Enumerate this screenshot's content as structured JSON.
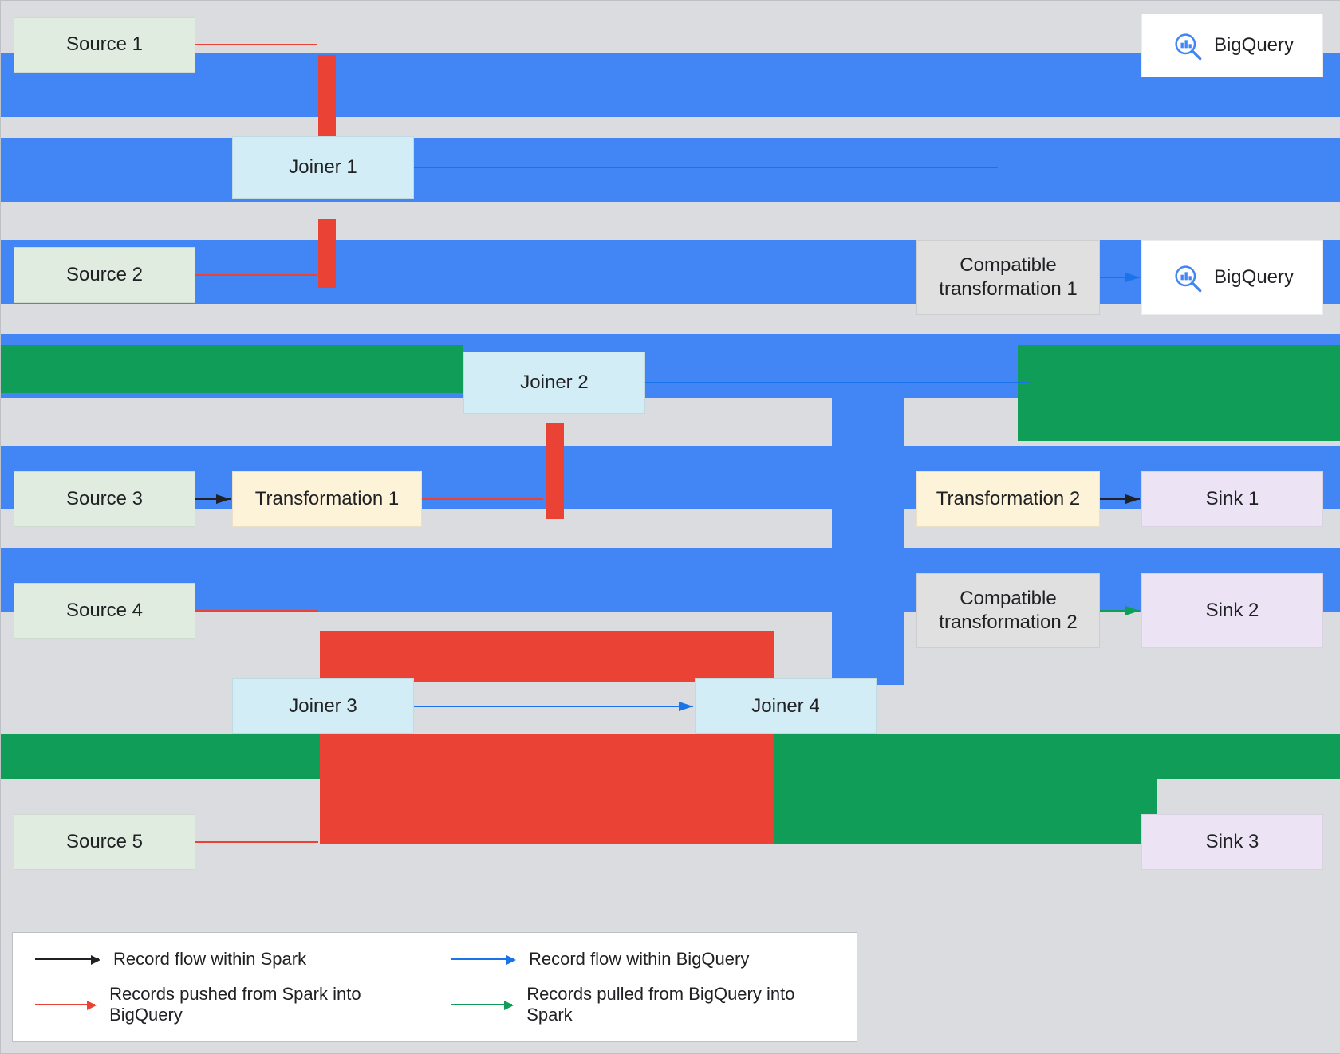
{
  "nodes": {
    "source1": "Source 1",
    "source2": "Source 2",
    "source3": "Source 3",
    "source4": "Source 4",
    "source5": "Source 5",
    "joiner1": "Joiner 1",
    "joiner2": "Joiner 2",
    "joiner3": "Joiner 3",
    "joiner4": "Joiner 4",
    "trans1": "Transformation 1",
    "trans2": "Transformation 2",
    "comp1": "Compatible transformation 1",
    "comp2": "Compatible transformation 2",
    "sink1": "Sink 1",
    "sink2": "Sink 2",
    "sink3": "Sink 3",
    "bigquery": "BigQuery"
  },
  "legend": {
    "black": "Record flow within Spark",
    "blue": "Record flow within BigQuery",
    "red": "Records pushed from Spark into BigQuery",
    "green": "Records pulled from BigQuery into Spark"
  },
  "colors": {
    "blue": "#4285f4",
    "green": "#0f9d58",
    "red": "#ea4335",
    "gray_bg": "#dadce0"
  }
}
